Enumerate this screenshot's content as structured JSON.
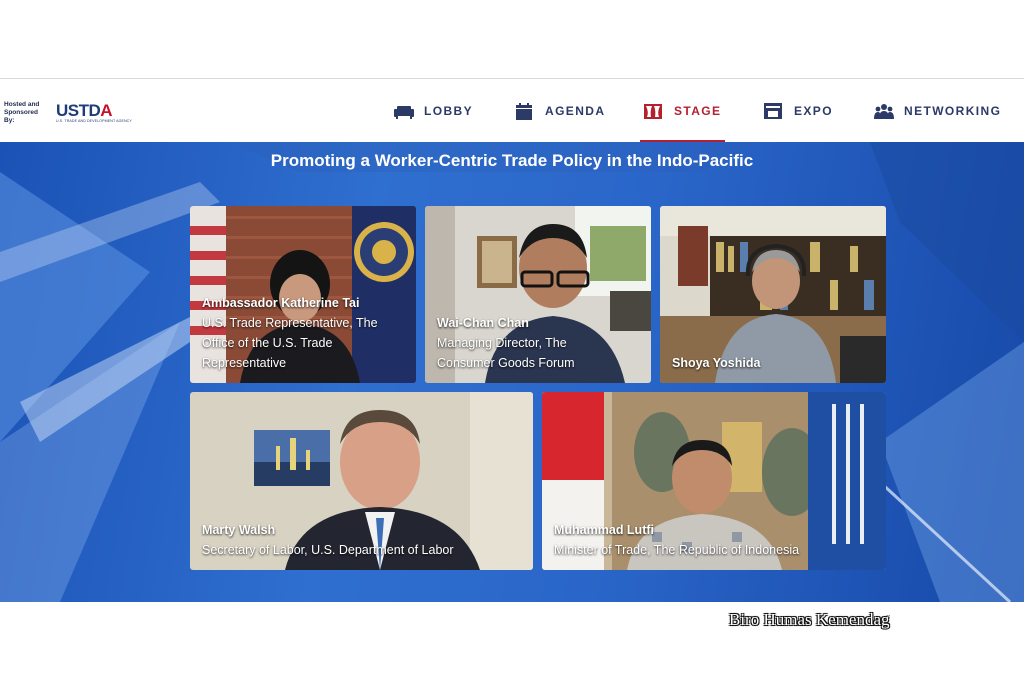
{
  "sponsor": {
    "hosted_label": "Hosted and Sponsored By:",
    "logo_text": "USTDA",
    "logo_subtext": "U.S. TRADE AND DEVELOPMENT AGENCY"
  },
  "nav": {
    "items": [
      {
        "label": "LOBBY",
        "icon": "sofa-icon",
        "active": false
      },
      {
        "label": "AGENDA",
        "icon": "calendar-icon",
        "active": false
      },
      {
        "label": "STAGE",
        "icon": "stage-icon",
        "active": true
      },
      {
        "label": "EXPO",
        "icon": "booth-icon",
        "active": false
      },
      {
        "label": "NETWORKING",
        "icon": "people-icon",
        "active": false
      }
    ],
    "active_color": "#b5202e",
    "text_color": "#2b3a67"
  },
  "stage": {
    "title": "Promoting a Worker-Centric Trade Policy in the Indo-Pacific",
    "speakers": [
      {
        "name": "Ambassador Katherine Tai",
        "role_lines": [
          "U.S. Trade Representative, The",
          "Office of the U.S. Trade",
          "Representative"
        ]
      },
      {
        "name": "Wai-Chan Chan",
        "role_lines": [
          "Managing Director, The",
          "Consumer Goods Forum"
        ]
      },
      {
        "name": "Shoya Yoshida",
        "role_lines": []
      },
      {
        "name": "Marty Walsh",
        "role_lines": [
          "Secretary of Labor, U.S. Department of Labor"
        ]
      },
      {
        "name": "Muhammad Lutfi",
        "role_lines": [
          "Minister of Trade, The Republic of Indonesia"
        ]
      }
    ]
  },
  "credit": "Biro Humas Kemendag"
}
